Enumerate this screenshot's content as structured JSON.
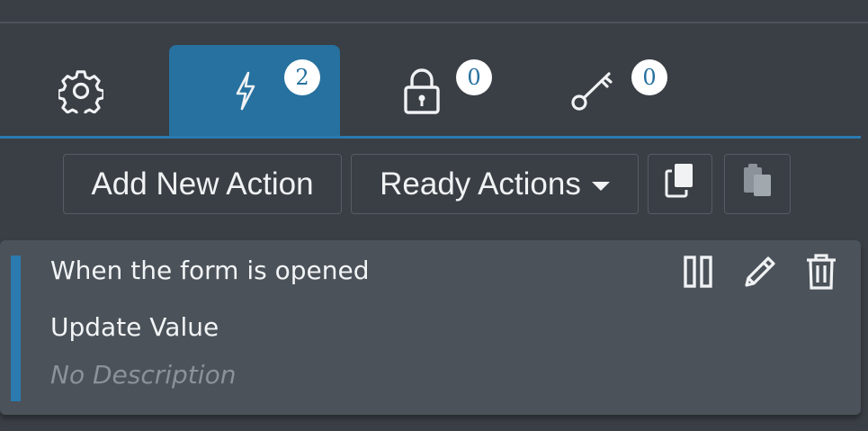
{
  "tabs": [
    {
      "icon": "gear-icon",
      "badge": null,
      "active": false
    },
    {
      "icon": "lightning-icon",
      "badge": "2",
      "active": true
    },
    {
      "icon": "lock-icon",
      "badge": "0",
      "active": false
    },
    {
      "icon": "key-icon",
      "badge": "0",
      "active": false
    }
  ],
  "toolbar": {
    "add_label": "Add New Action",
    "ready_label": "Ready Actions",
    "copy_icon": "copy-icon",
    "paste_icon": "paste-icon"
  },
  "action": {
    "trigger": "When the form is opened",
    "title": "Update Value",
    "description": "No Description",
    "tools": [
      "pause-icon",
      "pencil-icon",
      "trash-icon"
    ]
  },
  "colors": {
    "background": "#3a3f45",
    "accent": "#26719f",
    "card": "#4b5259",
    "text": "#f2f4f6",
    "muted": "#8b9299"
  }
}
